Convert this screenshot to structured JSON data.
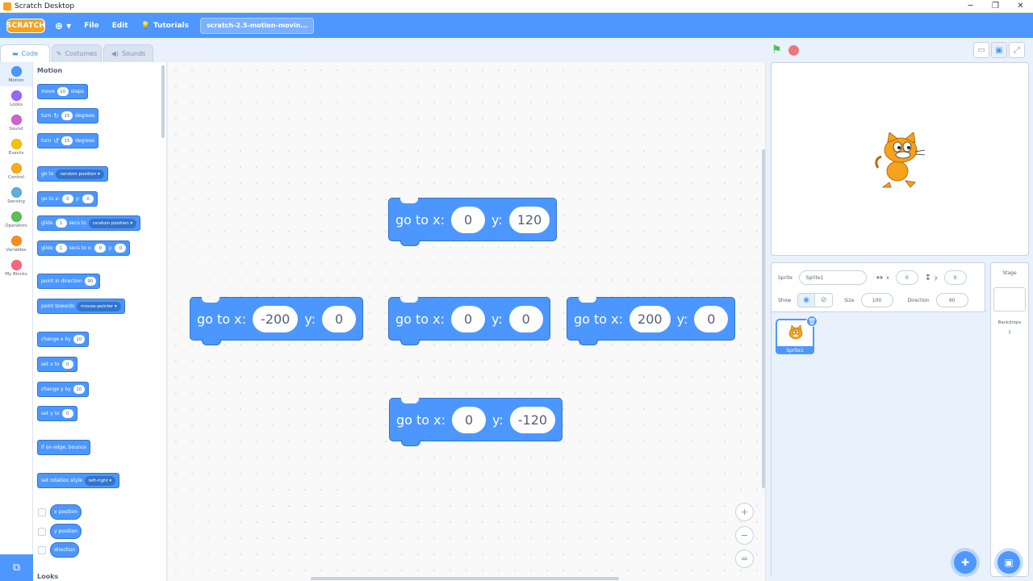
{
  "window": {
    "title": "Scratch Desktop",
    "minimize": "─",
    "maximize": "❐",
    "close": "✕"
  },
  "menu": {
    "logo": "SCRATCH",
    "globe": "⊕ ▾",
    "file": "File",
    "edit": "Edit",
    "tutorials": "Tutorials",
    "project_title": "scratch-2.5-motion-movin..."
  },
  "tabs": [
    {
      "label": "Code",
      "icon": "code-icon"
    },
    {
      "label": "Costumes",
      "icon": "brush-icon"
    },
    {
      "label": "Sounds",
      "icon": "speaker-icon"
    }
  ],
  "categories": [
    {
      "label": "Motion",
      "color": "#4c97ff"
    },
    {
      "label": "Looks",
      "color": "#9966ff"
    },
    {
      "label": "Sound",
      "color": "#cf63cf"
    },
    {
      "label": "Events",
      "color": "#ffbf00"
    },
    {
      "label": "Control",
      "color": "#ffab19"
    },
    {
      "label": "Sensing",
      "color": "#5cb1d6"
    },
    {
      "label": "Operators",
      "color": "#59c059"
    },
    {
      "label": "Variables",
      "color": "#ff8c1a"
    },
    {
      "label": "My Blocks",
      "color": "#ff6680"
    }
  ],
  "palette": {
    "section": "Motion",
    "next_section": "Looks",
    "move": {
      "a": "move",
      "v": "10",
      "b": "steps"
    },
    "turn_cw": {
      "a": "turn",
      "v": "15",
      "b": "degrees"
    },
    "turn_ccw": {
      "a": "turn",
      "v": "15",
      "b": "degrees"
    },
    "goto": {
      "a": "go to",
      "d": "random position ▾"
    },
    "gotoxy": {
      "a": "go to x:",
      "x": "0",
      "b": "y:",
      "y": "0"
    },
    "glide_to": {
      "a": "glide",
      "v": "1",
      "b": "secs to",
      "d": "random position ▾"
    },
    "glide_xy": {
      "a": "glide",
      "v": "1",
      "b": "secs to x:",
      "x": "0",
      "c": "y:",
      "y": "0"
    },
    "point_dir": {
      "a": "point in direction",
      "v": "90"
    },
    "point_towards": {
      "a": "point towards",
      "d": "mouse-pointer ▾"
    },
    "change_x": {
      "a": "change x by",
      "v": "10"
    },
    "set_x": {
      "a": "set x to",
      "v": "0"
    },
    "change_y": {
      "a": "change y by",
      "v": "10"
    },
    "set_y": {
      "a": "set y to",
      "v": "0"
    },
    "bounce": {
      "a": "if on edge, bounce"
    },
    "rot_style": {
      "a": "set rotation style",
      "d": "left-right ▾"
    },
    "x_position": "x position",
    "y_position": "y position",
    "direction": "direction"
  },
  "workspace_blocks": [
    {
      "label": "go to x:",
      "x": "0",
      "ylabel": "y:",
      "y": "120"
    },
    {
      "label": "go to x:",
      "x": "-200",
      "ylabel": "y:",
      "y": "0"
    },
    {
      "label": "go to x:",
      "x": "0",
      "ylabel": "y:",
      "y": "0"
    },
    {
      "label": "go to x:",
      "x": "200",
      "ylabel": "y:",
      "y": "0"
    },
    {
      "label": "go to x:",
      "x": "0",
      "ylabel": "y:",
      "y": "-120"
    }
  ],
  "zoom": {
    "in": "+",
    "out": "−",
    "reset": "="
  },
  "sprite_info": {
    "sprite_label": "Sprite",
    "sprite_name": "Sprite1",
    "x_label": "x",
    "x_value": "0",
    "y_label": "y",
    "y_value": "0",
    "show_label": "Show",
    "size_label": "Size",
    "size_value": "100",
    "direction_label": "Direction",
    "direction_value": "90"
  },
  "sprites": [
    {
      "name": "Sprite1"
    }
  ],
  "stage_panel": {
    "title": "Stage",
    "backdrops_label": "Backdrops",
    "backdrops_count": "1"
  }
}
